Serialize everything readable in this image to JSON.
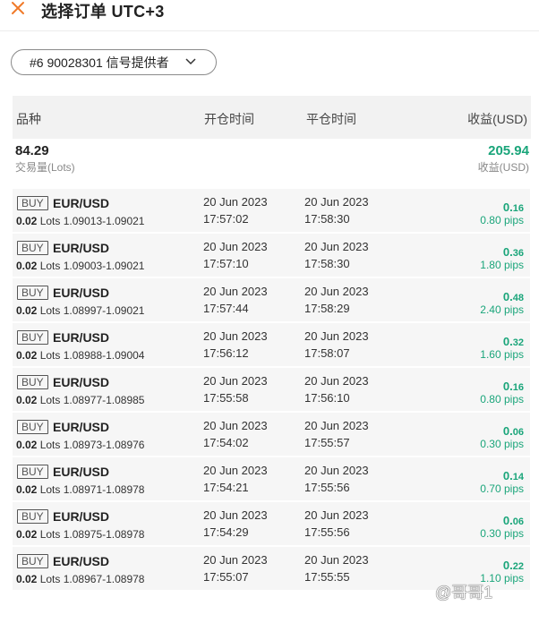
{
  "header": {
    "title": "选择订单 UTC+3"
  },
  "provider_selector": {
    "label": "#6 90028301 信号提供者"
  },
  "table": {
    "columns": [
      "品种",
      "开仓时间",
      "平仓时间",
      "收益(USD)"
    ]
  },
  "summary": {
    "volume_value": "84.29",
    "volume_label": "交易量(Lots)",
    "profit_value": "205.94",
    "profit_label": "收益(USD)"
  },
  "colors": {
    "profit_green": "#1aa57a"
  },
  "orders": [
    {
      "side": "BUY",
      "symbol": "EUR/USD",
      "lots": "0.02",
      "lots_unit": "Lots",
      "prices": "1.09013-1.09021",
      "open_date": "20 Jun 2023",
      "open_time": "17:57:02",
      "close_date": "20 Jun 2023",
      "close_time": "17:58:30",
      "profit_main": "0.",
      "profit_small": "16",
      "pips": "0.80 pips"
    },
    {
      "side": "BUY",
      "symbol": "EUR/USD",
      "lots": "0.02",
      "lots_unit": "Lots",
      "prices": "1.09003-1.09021",
      "open_date": "20 Jun 2023",
      "open_time": "17:57:10",
      "close_date": "20 Jun 2023",
      "close_time": "17:58:30",
      "profit_main": "0.",
      "profit_small": "36",
      "pips": "1.80 pips"
    },
    {
      "side": "BUY",
      "symbol": "EUR/USD",
      "lots": "0.02",
      "lots_unit": "Lots",
      "prices": "1.08997-1.09021",
      "open_date": "20 Jun 2023",
      "open_time": "17:57:44",
      "close_date": "20 Jun 2023",
      "close_time": "17:58:29",
      "profit_main": "0.",
      "profit_small": "48",
      "pips": "2.40 pips"
    },
    {
      "side": "BUY",
      "symbol": "EUR/USD",
      "lots": "0.02",
      "lots_unit": "Lots",
      "prices": "1.08988-1.09004",
      "open_date": "20 Jun 2023",
      "open_time": "17:56:12",
      "close_date": "20 Jun 2023",
      "close_time": "17:58:07",
      "profit_main": "0.",
      "profit_small": "32",
      "pips": "1.60 pips"
    },
    {
      "side": "BUY",
      "symbol": "EUR/USD",
      "lots": "0.02",
      "lots_unit": "Lots",
      "prices": "1.08977-1.08985",
      "open_date": "20 Jun 2023",
      "open_time": "17:55:58",
      "close_date": "20 Jun 2023",
      "close_time": "17:56:10",
      "profit_main": "0.",
      "profit_small": "16",
      "pips": "0.80 pips"
    },
    {
      "side": "BUY",
      "symbol": "EUR/USD",
      "lots": "0.02",
      "lots_unit": "Lots",
      "prices": "1.08973-1.08976",
      "open_date": "20 Jun 2023",
      "open_time": "17:54:02",
      "close_date": "20 Jun 2023",
      "close_time": "17:55:57",
      "profit_main": "0.",
      "profit_small": "06",
      "pips": "0.30 pips"
    },
    {
      "side": "BUY",
      "symbol": "EUR/USD",
      "lots": "0.02",
      "lots_unit": "Lots",
      "prices": "1.08971-1.08978",
      "open_date": "20 Jun 2023",
      "open_time": "17:54:21",
      "close_date": "20 Jun 2023",
      "close_time": "17:55:56",
      "profit_main": "0.",
      "profit_small": "14",
      "pips": "0.70 pips"
    },
    {
      "side": "BUY",
      "symbol": "EUR/USD",
      "lots": "0.02",
      "lots_unit": "Lots",
      "prices": "1.08975-1.08978",
      "open_date": "20 Jun 2023",
      "open_time": "17:54:29",
      "close_date": "20 Jun 2023",
      "close_time": "17:55:56",
      "profit_main": "0.",
      "profit_small": "06",
      "pips": "0.30 pips"
    },
    {
      "side": "BUY",
      "symbol": "EUR/USD",
      "lots": "0.02",
      "lots_unit": "Lots",
      "prices": "1.08967-1.08978",
      "open_date": "20 Jun 2023",
      "open_time": "17:55:07",
      "close_date": "20 Jun 2023",
      "close_time": "17:55:55",
      "profit_main": "0.",
      "profit_small": "22",
      "pips": "1.10 pips"
    }
  ],
  "watermark": {
    "text": "@哥哥1"
  }
}
